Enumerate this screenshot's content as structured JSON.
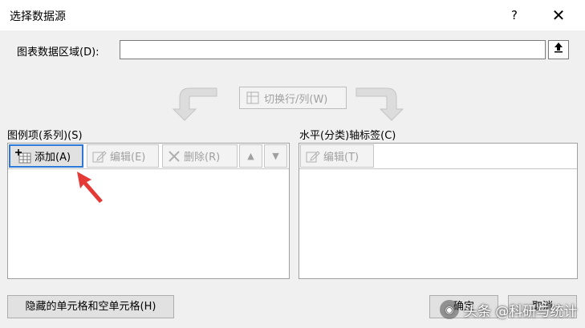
{
  "window": {
    "title": "选择数据源",
    "help_label": "?",
    "close_label": "✕"
  },
  "range": {
    "label": "图表数据区域(D):",
    "value": ""
  },
  "switch_row_col": {
    "label": "切换行/列(W)"
  },
  "legend_section": {
    "label": "图例项(系列)(S)",
    "add_label": "添加(A)",
    "edit_label": "编辑(E)",
    "delete_label": "删除(R)",
    "up_label": "▲",
    "down_label": "▼"
  },
  "axis_section": {
    "label": "水平(分类)轴标签(C)",
    "edit_label": "编辑(T)"
  },
  "footer": {
    "hidden_cells_label": "隐藏的单元格和空单元格(H)",
    "ok_label": "确定",
    "cancel_label": "取消"
  },
  "watermark": {
    "text": "头条 @科研与统计"
  },
  "colors": {
    "accent": "#2b78d8",
    "annotation_red": "#e53935"
  }
}
